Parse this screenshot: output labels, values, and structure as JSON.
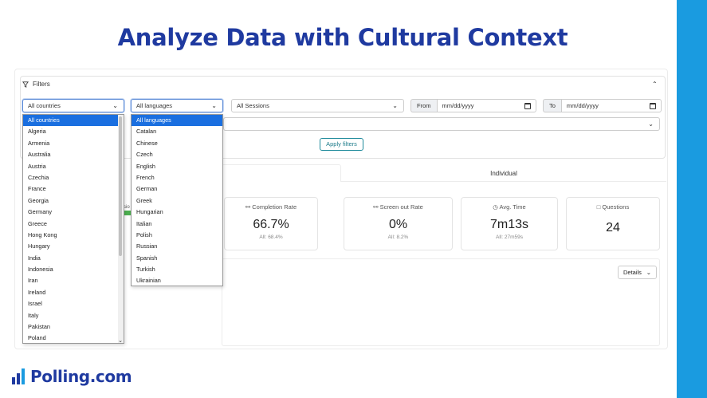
{
  "slide": {
    "title": "Analyze Data with Cultural Context"
  },
  "brand": {
    "logo_text": "Polling.com",
    "accent": "#1f3aa0",
    "band": "#1a9be0"
  },
  "filters": {
    "header": "Filters",
    "country_select": "All countries",
    "language_select": "All languages",
    "session_select": "All Sessions",
    "from_label": "From",
    "to_label": "To",
    "date_placeholder": "mm/dd/yyyy",
    "apply_label": "Apply filters"
  },
  "country_options": [
    "All countries",
    "Algeria",
    "Armenia",
    "Australia",
    "Austria",
    "Czechia",
    "France",
    "Georgia",
    "Germany",
    "Greece",
    "Hong Kong",
    "Hungary",
    "India",
    "Indonesia",
    "Iran",
    "Ireland",
    "Israel",
    "Italy",
    "Pakistan",
    "Poland"
  ],
  "language_options": [
    "All languages",
    "Catalan",
    "Chinese",
    "Czech",
    "English",
    "French",
    "German",
    "Greek",
    "Hungarian",
    "Italian",
    "Polish",
    "Russian",
    "Spanish",
    "Turkish",
    "Ukrainian"
  ],
  "tabs": {
    "individual": "Individual"
  },
  "stats": [
    {
      "label": "Completion Rate",
      "icon": "user-check-icon",
      "value": "66.7%",
      "sub": "All: 68.4%"
    },
    {
      "label": "Screen out Rate",
      "icon": "user-x-icon",
      "value": "0%",
      "sub": "All: 8.2%"
    },
    {
      "label": "Avg. Time",
      "icon": "clock-icon",
      "value": "7m13s",
      "sub": "All: 27m59s"
    },
    {
      "label": "Questions",
      "icon": "chat-icon",
      "value": "24",
      "sub": ""
    }
  ],
  "details": {
    "label": "Details"
  }
}
